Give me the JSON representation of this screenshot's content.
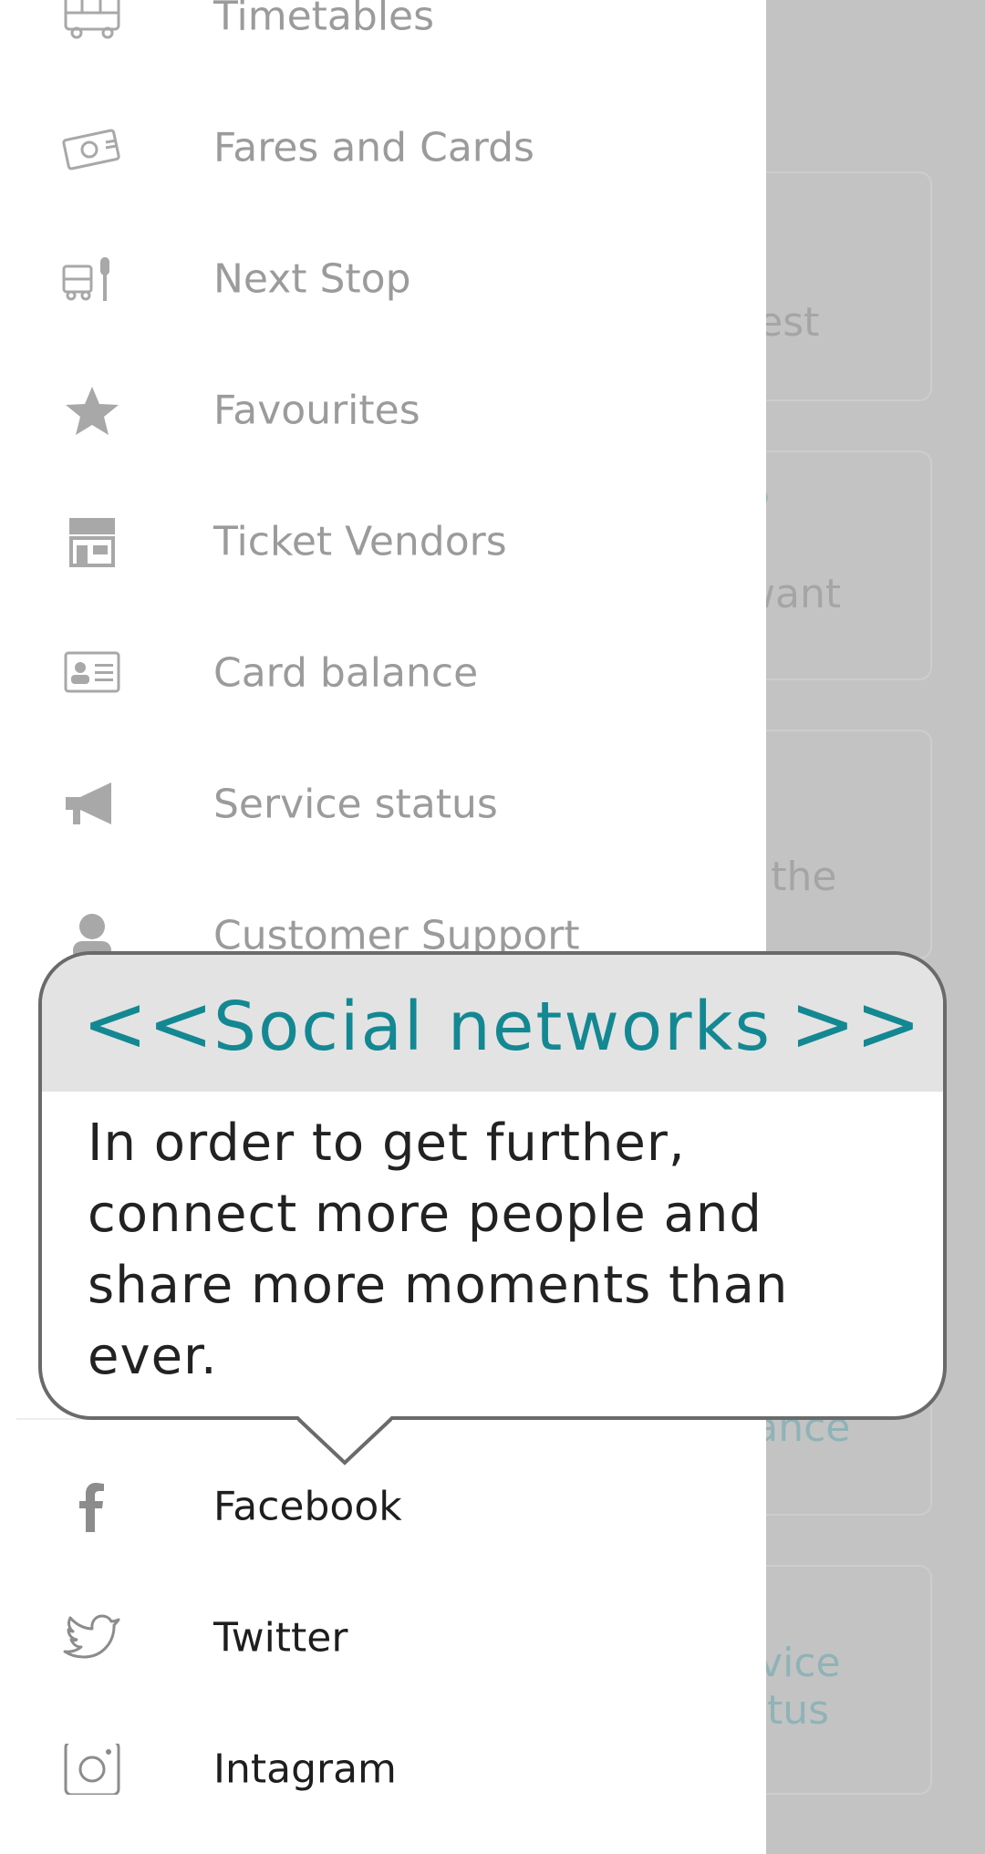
{
  "background": {
    "cards": [
      "rest",
      "?\nwant",
      "t the",
      "lance",
      "rvice\natus"
    ]
  },
  "drawer": {
    "items": [
      {
        "label": "Timetables",
        "icon": "bus-icon"
      },
      {
        "label": "Fares and Cards",
        "icon": "money-icon"
      },
      {
        "label": "Next Stop",
        "icon": "bus-stop-icon"
      },
      {
        "label": "Favourites",
        "icon": "star-icon"
      },
      {
        "label": "Ticket Vendors",
        "icon": "store-icon"
      },
      {
        "label": "Card balance",
        "icon": "id-card-icon"
      },
      {
        "label": "Service status",
        "icon": "megaphone-icon"
      },
      {
        "label": "Customer Support",
        "icon": "person-icon"
      }
    ],
    "social": [
      {
        "label": "Facebook",
        "icon": "facebook-icon"
      },
      {
        "label": "Twitter",
        "icon": "twitter-icon"
      },
      {
        "label": "Intagram",
        "icon": "instagram-icon"
      }
    ]
  },
  "tooltip": {
    "prev": "<<",
    "title": "Social networks",
    "next": ">>",
    "body": "In order to get further, connect more people and share more moments than ever."
  },
  "colors": {
    "accent": "#138892",
    "overlay": "#c3c3c3",
    "menu_text": "#9b9b9b"
  }
}
